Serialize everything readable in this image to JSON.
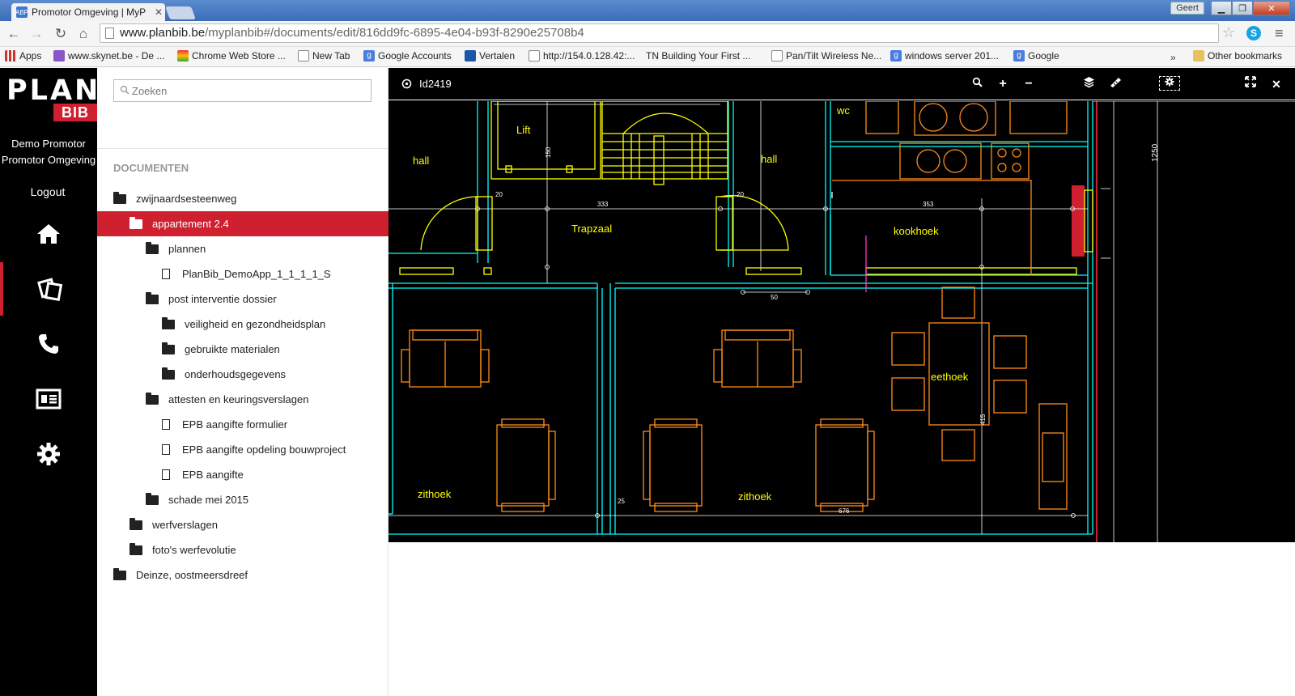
{
  "browser": {
    "tab_title": "Promotor Omgeving | MyP",
    "tab_favicon": "ABP",
    "user": "Geert",
    "url_host": "www.planbib.be",
    "url_path": "/myplanbib#/documents/edit/816dd9fc-6895-4e04-b93f-8290e25708b4",
    "bookmarks": [
      {
        "label": "Apps",
        "icon": "apps-icon"
      },
      {
        "label": "www.skynet.be - De ...",
        "icon": "skynet-icon"
      },
      {
        "label": "Chrome Web Store ...",
        "icon": "webstore-icon"
      },
      {
        "label": "New Tab",
        "icon": "page-icon"
      },
      {
        "label": "Google Accounts",
        "icon": "google-icon"
      },
      {
        "label": "Vertalen",
        "icon": "translate-icon"
      },
      {
        "label": "http://154.0.128.42:...",
        "icon": "page-icon"
      },
      {
        "label": "TN Building Your First ...",
        "icon": "tn-icon"
      },
      {
        "label": "Pan/Tilt Wireless Ne...",
        "icon": "page-icon"
      },
      {
        "label": "windows server 201...",
        "icon": "google-icon"
      },
      {
        "label": "Google",
        "icon": "google-icon"
      }
    ],
    "bookmarks_overflow": "»",
    "other_bookmarks": "Other bookmarks"
  },
  "sidebar": {
    "logo_top": "PLAN",
    "logo_bottom": "BIB",
    "user_line1": "Demo Promotor",
    "user_line2": "Promotor Omgeving",
    "logout": "Logout",
    "nav": [
      {
        "name": "home-icon",
        "active": false
      },
      {
        "name": "documents-icon",
        "active": true
      },
      {
        "name": "phone-icon",
        "active": false
      },
      {
        "name": "contact-card-icon",
        "active": false
      },
      {
        "name": "settings-gear-icon",
        "active": false
      }
    ]
  },
  "documents": {
    "search_placeholder": "Zoeken",
    "section_title": "DOCUMENTEN",
    "tree": [
      {
        "label": "zwijnaardsesteenweg",
        "type": "folder",
        "level": 0,
        "selected": false
      },
      {
        "label": "appartement 2.4",
        "type": "folder",
        "level": 1,
        "selected": true
      },
      {
        "label": "plannen",
        "type": "folder",
        "level": 2,
        "selected": false
      },
      {
        "label": "PlanBib_DemoApp_1_1_1_1_S",
        "type": "file",
        "level": 3,
        "selected": false
      },
      {
        "label": "post interventie dossier",
        "type": "folder",
        "level": 2,
        "selected": false
      },
      {
        "label": "veiligheid en gezondheidsplan",
        "type": "folder",
        "level": 3,
        "selected": false
      },
      {
        "label": "gebruikte materialen",
        "type": "folder",
        "level": 3,
        "selected": false
      },
      {
        "label": "onderhoudsgegevens",
        "type": "folder",
        "level": 3,
        "selected": false
      },
      {
        "label": "attesten en keuringsverslagen",
        "type": "folder",
        "level": 2,
        "selected": false
      },
      {
        "label": "EPB aangifte formulier",
        "type": "file",
        "level": 3,
        "selected": false
      },
      {
        "label": "EPB aangifte opdeling bouwproject",
        "type": "file",
        "level": 3,
        "selected": false
      },
      {
        "label": "EPB aangifte",
        "type": "file",
        "level": 3,
        "selected": false
      },
      {
        "label": "schade mei 2015",
        "type": "folder",
        "level": 2,
        "selected": false
      },
      {
        "label": "werfverslagen",
        "type": "folder",
        "level": 1,
        "selected": false
      },
      {
        "label": "foto's werfevolutie",
        "type": "folder",
        "level": 1,
        "selected": false
      },
      {
        "label": "Deinze, oostmeersdreef",
        "type": "folder",
        "level": 0,
        "selected": false
      }
    ]
  },
  "viewer": {
    "document_id": "Id2419",
    "tools": [
      "search-icon",
      "zoom-in-icon",
      "zoom-out-icon",
      "layers-icon",
      "measure-icon",
      "settings-icon",
      "fullscreen-icon",
      "close-icon"
    ],
    "plan_labels": [
      "hall",
      "Lift",
      "Trapzaal",
      "hall",
      "wc",
      "kookhoek",
      "eethoek",
      "zithoek",
      "zithoek"
    ],
    "dimension_labels": [
      "333",
      "353",
      "1250",
      "676",
      "50",
      "20",
      "20",
      "25",
      "150",
      "415"
    ],
    "colors": {
      "wall": "#00ffff",
      "label": "#ffff00",
      "furniture": "#ff8c1a",
      "dimension": "#ffffff",
      "accent": "#cf2030"
    }
  }
}
